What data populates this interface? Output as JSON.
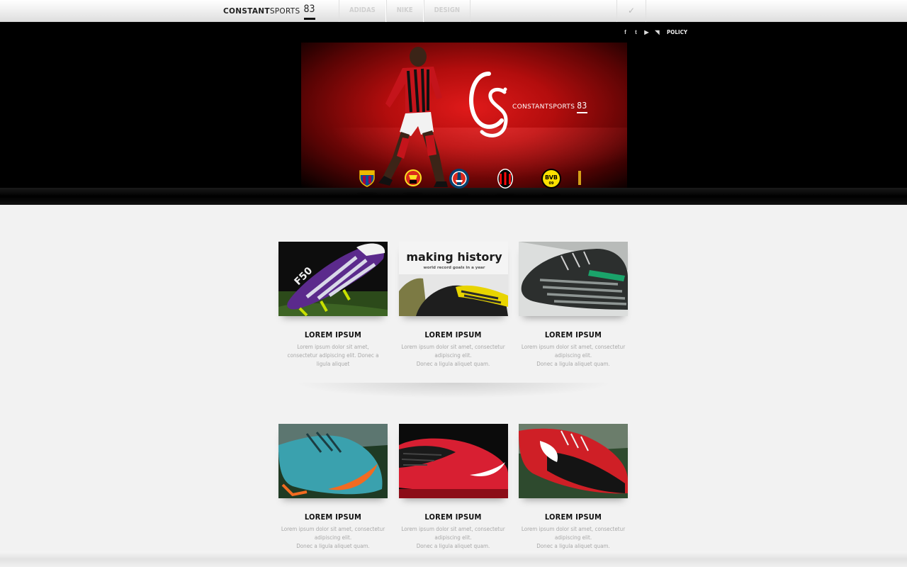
{
  "header": {
    "logo_text_bold": "CONSTANT",
    "logo_text_light": "SPORTS",
    "logo_number": "83",
    "nav": [
      {
        "label": "ADIDAS"
      },
      {
        "label": "NIKE"
      },
      {
        "label": "DESIGN"
      }
    ],
    "check_icon": "checkmark-icon"
  },
  "hero": {
    "social": [
      {
        "icon": "facebook-icon",
        "glyph": "f"
      },
      {
        "icon": "twitter-icon",
        "glyph": "t"
      },
      {
        "icon": "youtube-icon",
        "glyph": "▶"
      },
      {
        "icon": "rss-icon",
        "glyph": "◥"
      }
    ],
    "policy_label": "POLICY",
    "banner_brand": "CONSTANTSPORTS",
    "banner_number": "83",
    "clubs": [
      {
        "name": "fc-barcelona-logo",
        "colors": [
          "#a50044",
          "#004d98",
          "#edbb00"
        ]
      },
      {
        "name": "manchester-united-logo",
        "colors": [
          "#da291c",
          "#fbe122",
          "#000000"
        ]
      },
      {
        "name": "psg-logo",
        "colors": [
          "#004170",
          "#da291c",
          "#ffffff"
        ]
      },
      {
        "name": "ac-milan-logo",
        "colors": [
          "#fb090b",
          "#000000",
          "#ffffff"
        ]
      },
      {
        "name": "borussia-dortmund-logo",
        "colors": [
          "#fde100",
          "#000000"
        ]
      },
      {
        "name": "partial-club-logo",
        "colors": [
          "#d4a017"
        ]
      }
    ]
  },
  "products": [
    {
      "title": "LOREM IPSUM",
      "line1": "Lorem ipsum dolor sit amet,",
      "line2": "consectetur adipiscing elit. Donec a ligula aliquet",
      "image": "purple-adidas-boot",
      "image_caption": "",
      "image_sub": ""
    },
    {
      "title": "LOREM IPSUM",
      "line1": "Lorem ipsum dolor sit amet, consectetur adipiscing elit.",
      "line2": "Donec a ligula aliquet quam.",
      "image": "making-history-boots",
      "image_caption": "making history",
      "image_sub": "world record goals in a year"
    },
    {
      "title": "LOREM IPSUM",
      "line1": "Lorem ipsum dolor sit amet, consectetur adipiscing elit.",
      "line2": "Donec a ligula aliquet quam.",
      "image": "black-predator-boot",
      "image_caption": "",
      "image_sub": ""
    },
    {
      "title": "LOREM IPSUM",
      "line1": "Lorem ipsum dolor sit amet, consectetur adipiscing elit.",
      "line2": "Donec a ligula aliquet quam.",
      "image": "teal-nike-boot",
      "image_caption": "",
      "image_sub": ""
    },
    {
      "title": "LOREM IPSUM",
      "line1": "Lorem ipsum dolor sit amet, consectetur adipiscing elit.",
      "line2": "Donec a ligula aliquet quam.",
      "image": "red-nike-boot",
      "image_caption": "",
      "image_sub": ""
    },
    {
      "title": "LOREM IPSUM",
      "line1": "Lorem ipsum dolor sit amet, consectetur adipiscing elit.",
      "line2": "Donec a ligula aliquet quam.",
      "image": "red-black-nike-boot",
      "image_caption": "",
      "image_sub": ""
    }
  ]
}
